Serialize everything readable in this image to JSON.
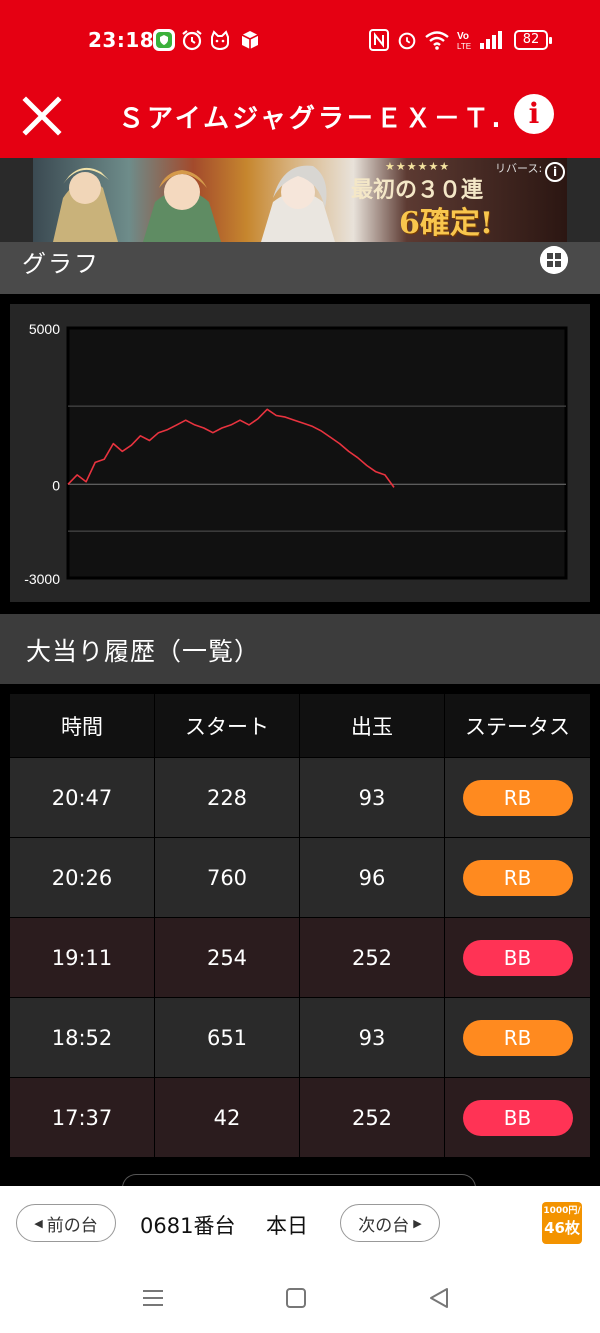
{
  "status_bar": {
    "time": "23:18",
    "battery": "82",
    "left_icons": [
      "line-icon",
      "alarm-icon",
      "cat-icon",
      "box-icon"
    ],
    "right_icons": [
      "nfc-icon",
      "alarm-icon",
      "wifi-icon",
      "volte-icon",
      "signal-icon",
      "battery-icon"
    ]
  },
  "header": {
    "title": "ＳアイムジャグラーＥＸ－Ｔ…",
    "close_icon": "close-icon",
    "info_icon": "info-icon",
    "info_glyph": "i",
    "bg_color": "#e50012"
  },
  "ad": {
    "stars": "★★★★★★",
    "line1": "最初の３０連",
    "line2": "6確定!",
    "brand": "リバース:",
    "info_glyph": "i"
  },
  "graph": {
    "title": "グラフ",
    "toggle_icon": "grid-icon"
  },
  "chart_data": {
    "type": "line",
    "yticks": [
      5000,
      0,
      -3000
    ],
    "ylim": [
      -3000,
      5000
    ],
    "gridlines": [
      2500,
      0,
      -1500
    ],
    "x": [
      0,
      1,
      2,
      3,
      4,
      5,
      6,
      7,
      8,
      9,
      10,
      11,
      12,
      13,
      14,
      15,
      16,
      17,
      18,
      19,
      20,
      21,
      22,
      23,
      24,
      25,
      26,
      27,
      28,
      29,
      30,
      31,
      32,
      33,
      34,
      35,
      36,
      37,
      38,
      39,
      40,
      41,
      42,
      43,
      44,
      45,
      46,
      47,
      48,
      49,
      50,
      51,
      52,
      53,
      54,
      55
    ],
    "series": [
      {
        "color": "#e8333f",
        "values": [
          0,
          300,
          80,
          700,
          800,
          1300,
          1050,
          1250,
          1550,
          1400,
          1650,
          1750,
          1900,
          2050,
          1900,
          1800,
          1650,
          1800,
          1900,
          2050,
          1900,
          2100,
          2400,
          2200,
          2150,
          2050,
          1950,
          1850,
          1700,
          1500,
          1300,
          1050,
          850,
          600,
          400,
          300,
          -100
        ]
      }
    ],
    "series_line_color": "#e8333f",
    "grid": true
  },
  "history": {
    "title": "大当り履歴（一覧）",
    "columns": [
      "時間",
      "スタート",
      "出玉",
      "ステータス"
    ],
    "rows": [
      {
        "time": "20:47",
        "start": "228",
        "payout": "93",
        "status": "RB",
        "kind": "rb"
      },
      {
        "time": "20:26",
        "start": "760",
        "payout": "96",
        "status": "RB",
        "kind": "rb"
      },
      {
        "time": "19:11",
        "start": "254",
        "payout": "252",
        "status": "BB",
        "kind": "bb"
      },
      {
        "time": "18:52",
        "start": "651",
        "payout": "93",
        "status": "RB",
        "kind": "rb"
      },
      {
        "time": "17:37",
        "start": "42",
        "payout": "252",
        "status": "BB",
        "kind": "bb"
      }
    ],
    "status_colors": {
      "RB": "#ff8a1f",
      "BB": "#ff3355"
    }
  },
  "bottom": {
    "prev_label": "前の台",
    "next_label": "次の台",
    "machine_number": "0681番台",
    "day_label": "本日",
    "coin_top": "1000円/",
    "coin_bottom": "46枚"
  }
}
